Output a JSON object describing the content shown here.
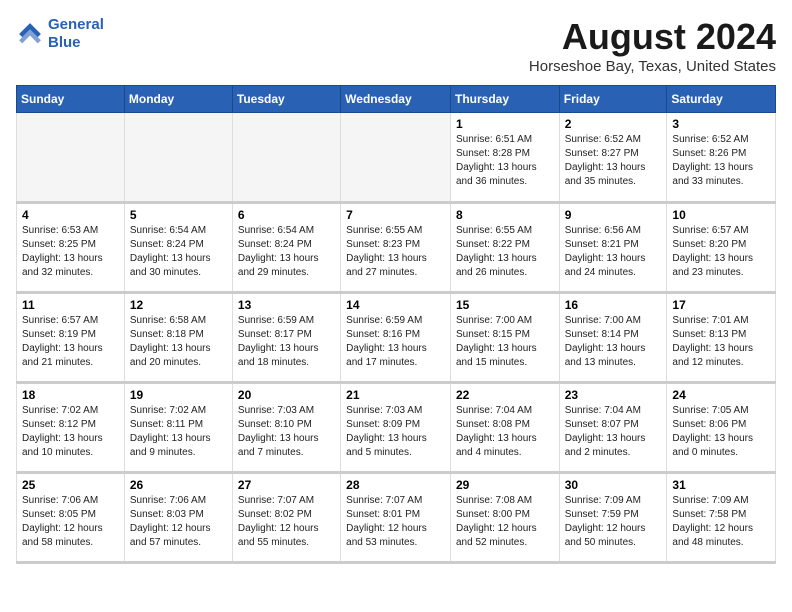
{
  "logo": {
    "line1": "General",
    "line2": "Blue"
  },
  "title": "August 2024",
  "subtitle": "Horseshoe Bay, Texas, United States",
  "days_of_week": [
    "Sunday",
    "Monday",
    "Tuesday",
    "Wednesday",
    "Thursday",
    "Friday",
    "Saturday"
  ],
  "weeks": [
    [
      {
        "day": "",
        "sunrise": "",
        "sunset": "",
        "daylight": "",
        "empty": true
      },
      {
        "day": "",
        "sunrise": "",
        "sunset": "",
        "daylight": "",
        "empty": true
      },
      {
        "day": "",
        "sunrise": "",
        "sunset": "",
        "daylight": "",
        "empty": true
      },
      {
        "day": "",
        "sunrise": "",
        "sunset": "",
        "daylight": "",
        "empty": true
      },
      {
        "day": "1",
        "sunrise": "6:51 AM",
        "sunset": "8:28 PM",
        "daylight": "13 hours and 36 minutes."
      },
      {
        "day": "2",
        "sunrise": "6:52 AM",
        "sunset": "8:27 PM",
        "daylight": "13 hours and 35 minutes."
      },
      {
        "day": "3",
        "sunrise": "6:52 AM",
        "sunset": "8:26 PM",
        "daylight": "13 hours and 33 minutes."
      }
    ],
    [
      {
        "day": "4",
        "sunrise": "6:53 AM",
        "sunset": "8:25 PM",
        "daylight": "13 hours and 32 minutes."
      },
      {
        "day": "5",
        "sunrise": "6:54 AM",
        "sunset": "8:24 PM",
        "daylight": "13 hours and 30 minutes."
      },
      {
        "day": "6",
        "sunrise": "6:54 AM",
        "sunset": "8:24 PM",
        "daylight": "13 hours and 29 minutes."
      },
      {
        "day": "7",
        "sunrise": "6:55 AM",
        "sunset": "8:23 PM",
        "daylight": "13 hours and 27 minutes."
      },
      {
        "day": "8",
        "sunrise": "6:55 AM",
        "sunset": "8:22 PM",
        "daylight": "13 hours and 26 minutes."
      },
      {
        "day": "9",
        "sunrise": "6:56 AM",
        "sunset": "8:21 PM",
        "daylight": "13 hours and 24 minutes."
      },
      {
        "day": "10",
        "sunrise": "6:57 AM",
        "sunset": "8:20 PM",
        "daylight": "13 hours and 23 minutes."
      }
    ],
    [
      {
        "day": "11",
        "sunrise": "6:57 AM",
        "sunset": "8:19 PM",
        "daylight": "13 hours and 21 minutes."
      },
      {
        "day": "12",
        "sunrise": "6:58 AM",
        "sunset": "8:18 PM",
        "daylight": "13 hours and 20 minutes."
      },
      {
        "day": "13",
        "sunrise": "6:59 AM",
        "sunset": "8:17 PM",
        "daylight": "13 hours and 18 minutes."
      },
      {
        "day": "14",
        "sunrise": "6:59 AM",
        "sunset": "8:16 PM",
        "daylight": "13 hours and 17 minutes."
      },
      {
        "day": "15",
        "sunrise": "7:00 AM",
        "sunset": "8:15 PM",
        "daylight": "13 hours and 15 minutes."
      },
      {
        "day": "16",
        "sunrise": "7:00 AM",
        "sunset": "8:14 PM",
        "daylight": "13 hours and 13 minutes."
      },
      {
        "day": "17",
        "sunrise": "7:01 AM",
        "sunset": "8:13 PM",
        "daylight": "13 hours and 12 minutes."
      }
    ],
    [
      {
        "day": "18",
        "sunrise": "7:02 AM",
        "sunset": "8:12 PM",
        "daylight": "13 hours and 10 minutes."
      },
      {
        "day": "19",
        "sunrise": "7:02 AM",
        "sunset": "8:11 PM",
        "daylight": "13 hours and 9 minutes."
      },
      {
        "day": "20",
        "sunrise": "7:03 AM",
        "sunset": "8:10 PM",
        "daylight": "13 hours and 7 minutes."
      },
      {
        "day": "21",
        "sunrise": "7:03 AM",
        "sunset": "8:09 PM",
        "daylight": "13 hours and 5 minutes."
      },
      {
        "day": "22",
        "sunrise": "7:04 AM",
        "sunset": "8:08 PM",
        "daylight": "13 hours and 4 minutes."
      },
      {
        "day": "23",
        "sunrise": "7:04 AM",
        "sunset": "8:07 PM",
        "daylight": "13 hours and 2 minutes."
      },
      {
        "day": "24",
        "sunrise": "7:05 AM",
        "sunset": "8:06 PM",
        "daylight": "13 hours and 0 minutes."
      }
    ],
    [
      {
        "day": "25",
        "sunrise": "7:06 AM",
        "sunset": "8:05 PM",
        "daylight": "12 hours and 58 minutes."
      },
      {
        "day": "26",
        "sunrise": "7:06 AM",
        "sunset": "8:03 PM",
        "daylight": "12 hours and 57 minutes."
      },
      {
        "day": "27",
        "sunrise": "7:07 AM",
        "sunset": "8:02 PM",
        "daylight": "12 hours and 55 minutes."
      },
      {
        "day": "28",
        "sunrise": "7:07 AM",
        "sunset": "8:01 PM",
        "daylight": "12 hours and 53 minutes."
      },
      {
        "day": "29",
        "sunrise": "7:08 AM",
        "sunset": "8:00 PM",
        "daylight": "12 hours and 52 minutes."
      },
      {
        "day": "30",
        "sunrise": "7:09 AM",
        "sunset": "7:59 PM",
        "daylight": "12 hours and 50 minutes."
      },
      {
        "day": "31",
        "sunrise": "7:09 AM",
        "sunset": "7:58 PM",
        "daylight": "12 hours and 48 minutes."
      }
    ]
  ],
  "labels": {
    "sunrise_prefix": "Sunrise: ",
    "sunset_prefix": "Sunset: ",
    "daylight_prefix": "Daylight: "
  },
  "colors": {
    "header_bg": "#2962b5",
    "header_text": "#ffffff",
    "logo_blue": "#2962b5"
  }
}
